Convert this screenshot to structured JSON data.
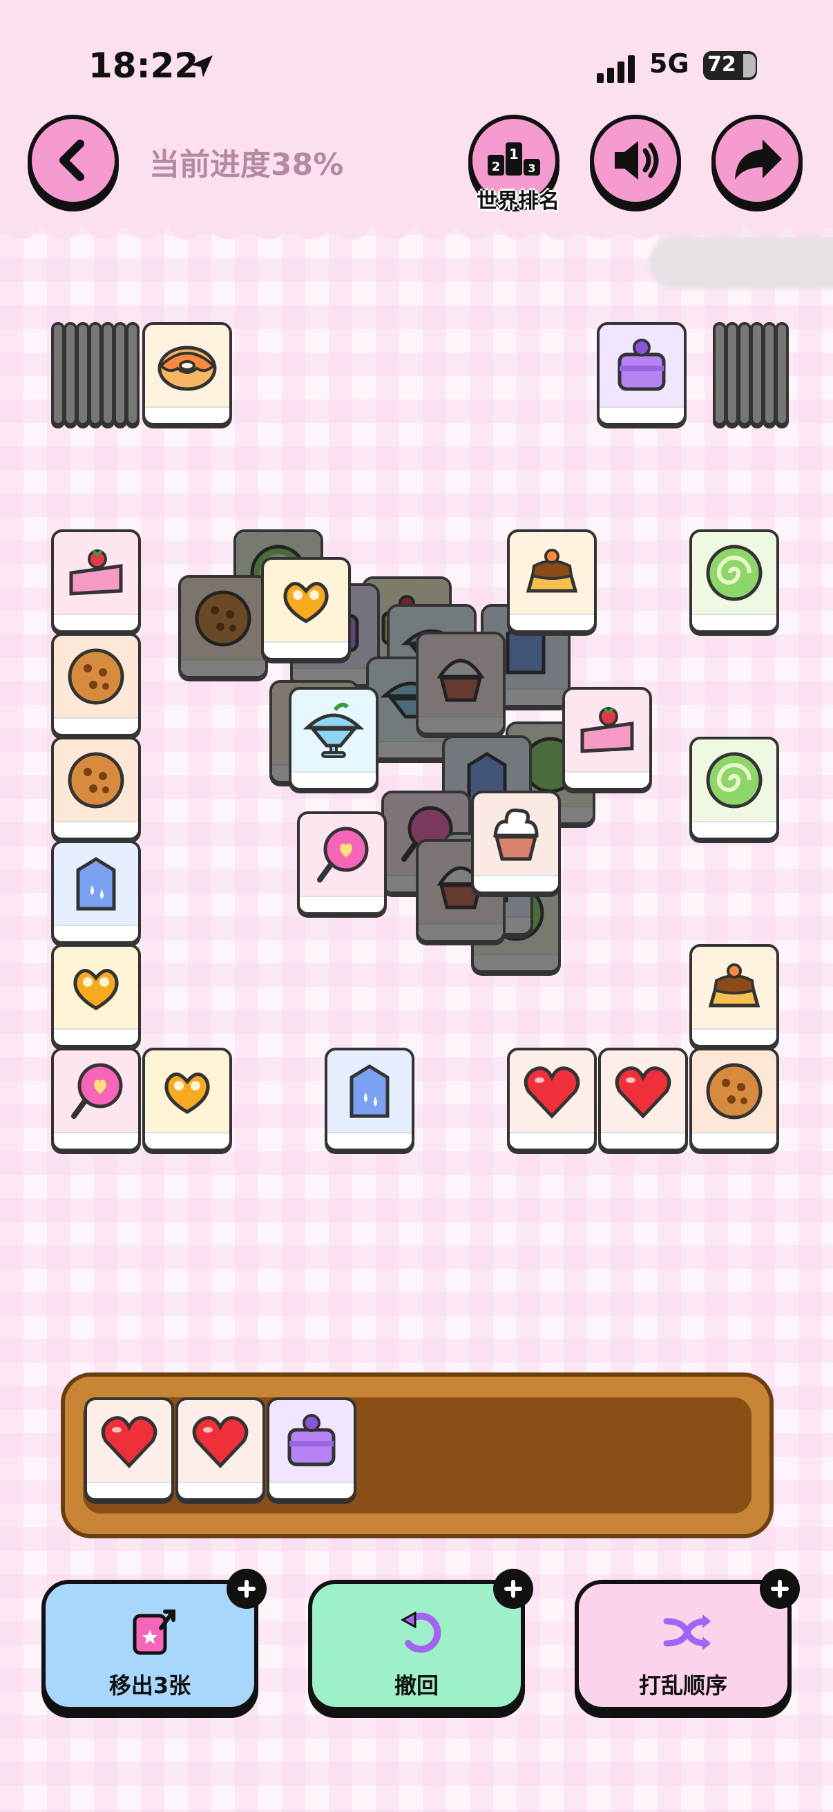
{
  "status_bar": {
    "time": "18:22",
    "network": "5G",
    "battery": "72"
  },
  "header": {
    "progress_text": "当前进度38%",
    "rank_label": "世界排名"
  },
  "tray": {
    "items": [
      "heart-tile",
      "heart-tile",
      "purple-cake-tile"
    ]
  },
  "actions": [
    {
      "label": "移出3张"
    },
    {
      "label": "撤回"
    },
    {
      "label": "打乱顺序"
    }
  ],
  "colors": {
    "pink_button": "#f59bd0",
    "header_bg": "#fde0f0",
    "tray_wood": "#c88535"
  }
}
